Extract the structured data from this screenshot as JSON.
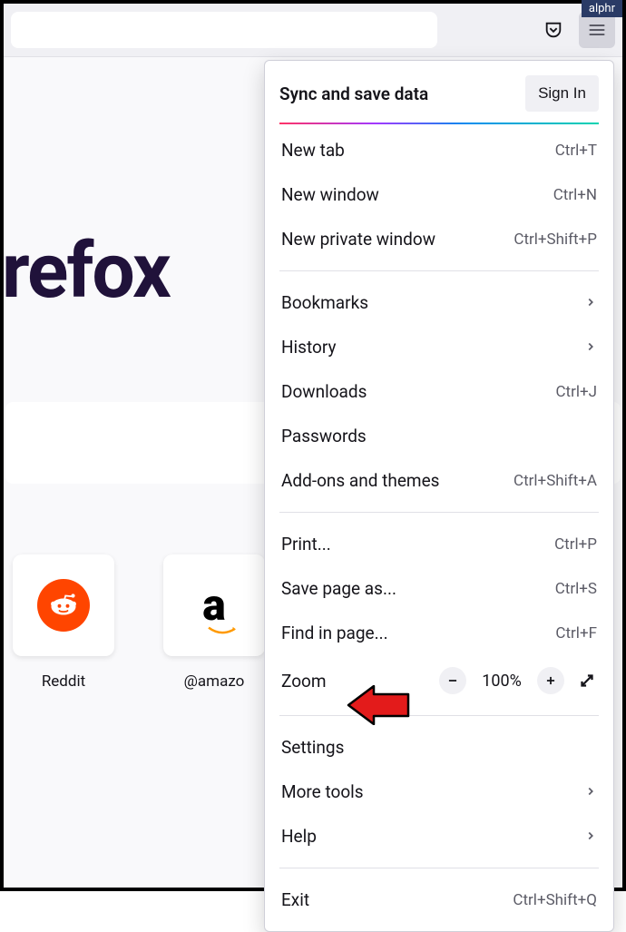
{
  "watermark": "alphr",
  "logo_text": "refox",
  "tiles": [
    {
      "label": "Reddit",
      "name": "reddit"
    },
    {
      "label": "@amazo",
      "name": "amazon"
    }
  ],
  "menu": {
    "sync_title": "Sync and save data",
    "sign_in": "Sign In",
    "items": {
      "new_tab": {
        "label": "New tab",
        "shortcut": "Ctrl+T"
      },
      "new_window": {
        "label": "New window",
        "shortcut": "Ctrl+N"
      },
      "new_private": {
        "label": "New private window",
        "shortcut": "Ctrl+Shift+P"
      },
      "bookmarks": {
        "label": "Bookmarks"
      },
      "history": {
        "label": "History"
      },
      "downloads": {
        "label": "Downloads",
        "shortcut": "Ctrl+J"
      },
      "passwords": {
        "label": "Passwords"
      },
      "addons": {
        "label": "Add-ons and themes",
        "shortcut": "Ctrl+Shift+A"
      },
      "print": {
        "label": "Print...",
        "shortcut": "Ctrl+P"
      },
      "save_as": {
        "label": "Save page as...",
        "shortcut": "Ctrl+S"
      },
      "find": {
        "label": "Find in page...",
        "shortcut": "Ctrl+F"
      },
      "zoom": {
        "label": "Zoom",
        "value": "100%"
      },
      "settings": {
        "label": "Settings"
      },
      "more_tools": {
        "label": "More tools"
      },
      "help": {
        "label": "Help"
      },
      "exit": {
        "label": "Exit",
        "shortcut": "Ctrl+Shift+Q"
      }
    }
  }
}
